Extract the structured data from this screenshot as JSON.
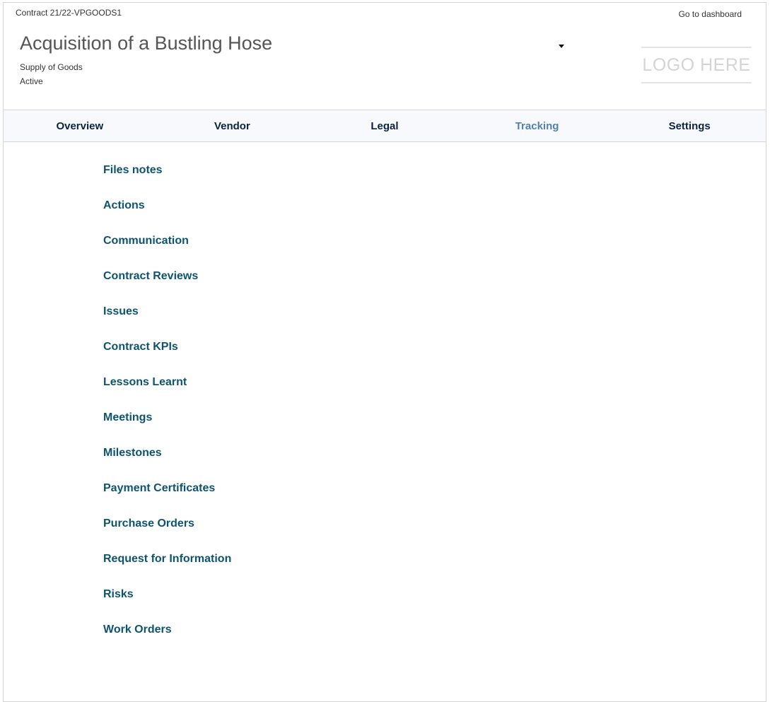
{
  "header": {
    "contract_ref": "Contract 21/22-VPGOODS1",
    "dashboard_link": "Go to dashboard",
    "title": "Acquisition of a Bustling Hose",
    "type": "Supply of Goods",
    "status": "Active",
    "logo_text": "LOGO HERE"
  },
  "tabs": [
    {
      "label": "Overview",
      "active": false
    },
    {
      "label": "Vendor",
      "active": false
    },
    {
      "label": "Legal",
      "active": false
    },
    {
      "label": "Tracking",
      "active": true
    },
    {
      "label": "Settings",
      "active": false
    }
  ],
  "tracking_menu": [
    "Files notes",
    "Actions",
    "Communication",
    "Contract Reviews",
    "Issues",
    "Contract KPIs",
    "Lessons Learnt",
    "Meetings",
    "Milestones",
    "Payment Certificates",
    "Purchase Orders",
    "Request for Information",
    "Risks",
    "Work Orders"
  ],
  "colors": {
    "tab_text": "#0c2340",
    "tab_active": "#5082ad",
    "menu_link": "#0d5470",
    "tabbar_bg": "#f7f9fc"
  },
  "icons": {
    "dropdown": "caret-down-icon"
  }
}
